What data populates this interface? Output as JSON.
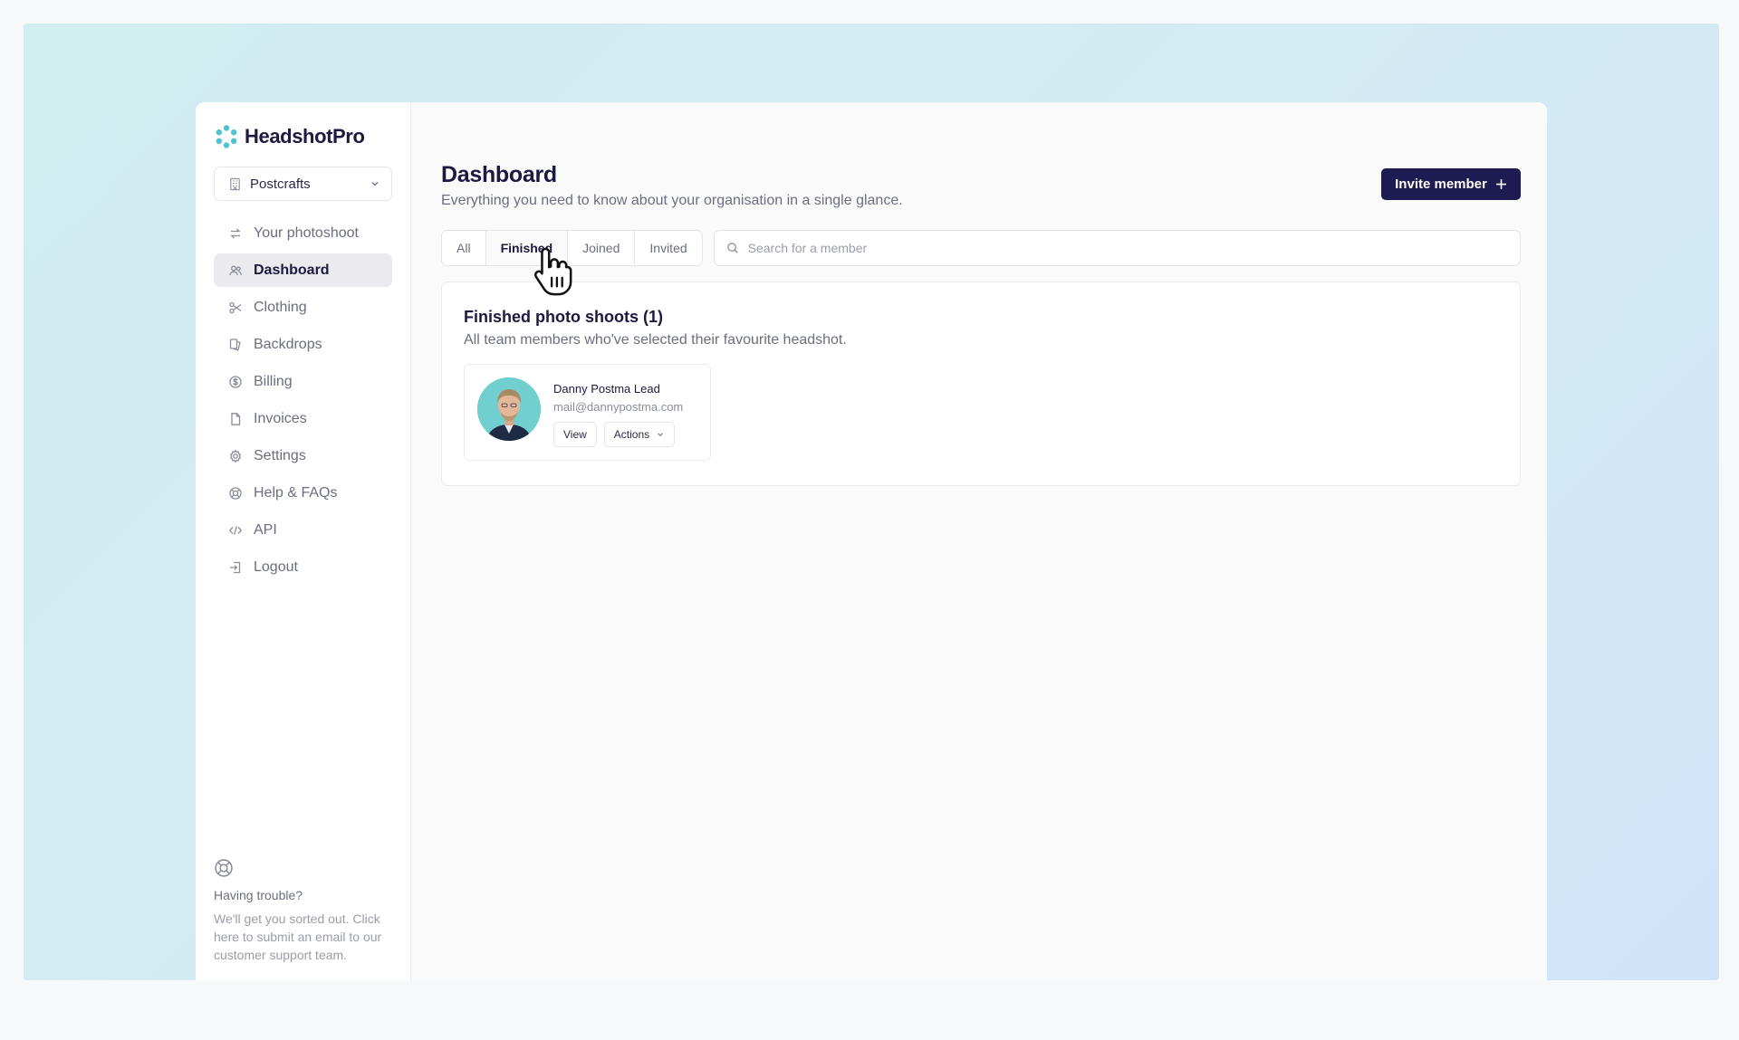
{
  "brand": {
    "name": "HeadshotPro"
  },
  "org_selector": {
    "value": "Postcrafts"
  },
  "sidebar": {
    "items": [
      {
        "label": "Your photoshoot",
        "icon": "swap-arrows-icon"
      },
      {
        "label": "Dashboard",
        "icon": "users-icon",
        "active": true
      },
      {
        "label": "Clothing",
        "icon": "scissors-icon"
      },
      {
        "label": "Backdrops",
        "icon": "image-stack-icon"
      },
      {
        "label": "Billing",
        "icon": "dollar-circle-icon"
      },
      {
        "label": "Invoices",
        "icon": "document-icon"
      },
      {
        "label": "Settings",
        "icon": "gear-icon"
      },
      {
        "label": "Help & FAQs",
        "icon": "lifebuoy-icon"
      },
      {
        "label": "API",
        "icon": "code-icon"
      },
      {
        "label": "Logout",
        "icon": "logout-icon"
      }
    ],
    "help": {
      "title": "Having trouble?",
      "text": "We'll get you sorted out. Click here to submit an email to our customer support team."
    }
  },
  "header": {
    "title": "Dashboard",
    "subtitle": "Everything you need to know about your organisation in a single glance.",
    "invite_label": "Invite member"
  },
  "tabs": [
    {
      "label": "All"
    },
    {
      "label": "Finished",
      "active": true
    },
    {
      "label": "Joined"
    },
    {
      "label": "Invited"
    }
  ],
  "search": {
    "placeholder": "Search for a member"
  },
  "panel": {
    "title": "Finished photo shoots (1)",
    "subtitle": "All team members who've selected their favourite headshot."
  },
  "members": [
    {
      "name": "Danny Postma Lead",
      "email": "mail@dannypostma.com",
      "view_label": "View",
      "actions_label": "Actions"
    }
  ],
  "colors": {
    "primary": "#1e1a52",
    "brand_accent": "#4ec3d4",
    "avatar_bg": "#72cfcf"
  }
}
